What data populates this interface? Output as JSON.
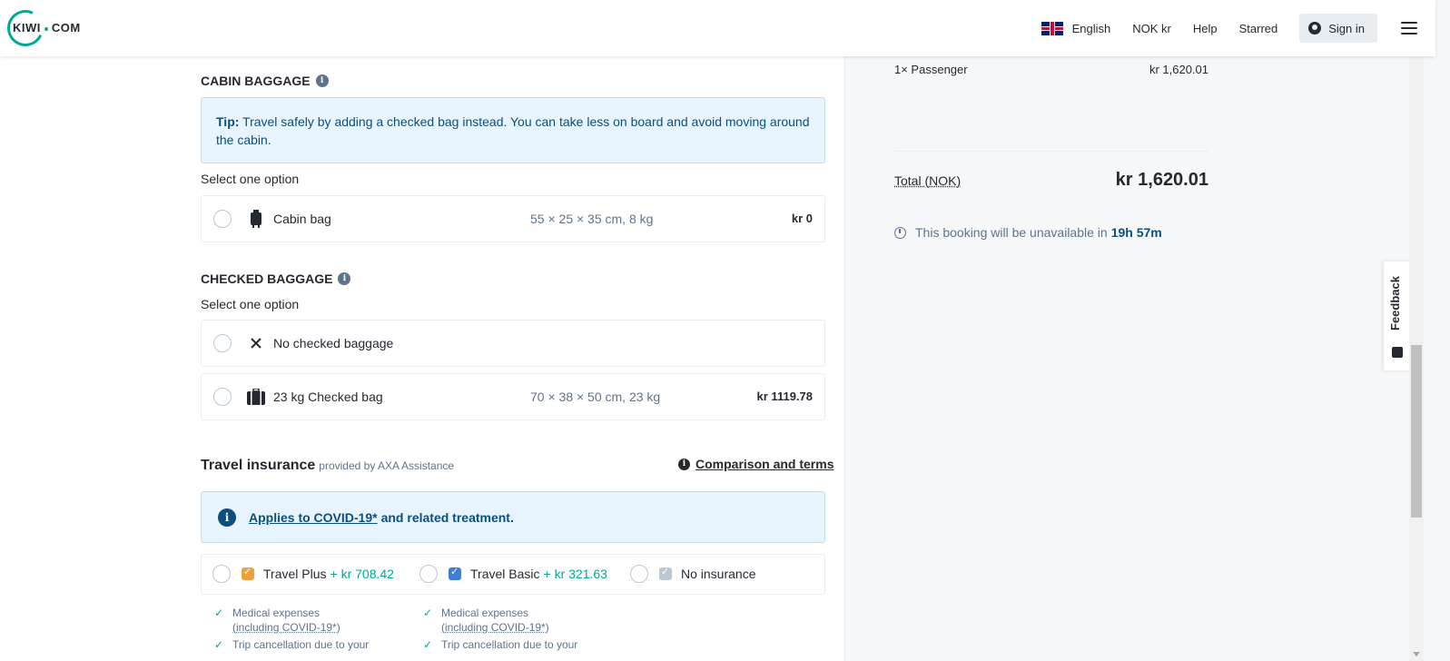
{
  "header": {
    "logo_text_left": "KIWI",
    "logo_text_right": "COM",
    "language": "English",
    "currency": "NOK kr",
    "help": "Help",
    "starred": "Starred",
    "sign_in": "Sign in"
  },
  "cabin": {
    "title": "CABIN BAGGAGE",
    "tip_bold": "Tip:",
    "tip_text": " Travel safely by adding a checked bag instead. You can take less on board and avoid moving around the cabin.",
    "select_label": "Select one option",
    "options": [
      {
        "label": "Cabin bag",
        "dims": "55 × 25 × 35 cm, 8 kg",
        "price": "kr 0"
      }
    ]
  },
  "checked": {
    "title": "CHECKED BAGGAGE",
    "select_label": "Select one option",
    "options": [
      {
        "label": "No checked baggage"
      },
      {
        "label": "23 kg Checked bag",
        "dims": "70 × 38 × 50 cm, 23 kg",
        "price": "kr 1119.78"
      }
    ]
  },
  "insurance": {
    "title": "Travel insurance",
    "provider": "provided by AXA Assistance",
    "comparison": "Comparison and terms",
    "covid_link": "Applies to COVID-19*",
    "covid_rest": "and related treatment.",
    "options": [
      {
        "label": "Travel Plus",
        "price": "+ kr 708.42",
        "color": "#f0a03a"
      },
      {
        "label": "Travel Basic",
        "price": "+ kr 321.63",
        "color": "#3d7fd6"
      },
      {
        "label": "No insurance"
      }
    ],
    "features_col1": [
      {
        "line1": "Medical expenses",
        "line2": "(including COVID-19*)"
      },
      {
        "line1": "Trip cancellation due to your"
      }
    ],
    "features_col2": [
      {
        "line1": "Medical expenses",
        "line2": "(including COVID-19*)"
      },
      {
        "line1": "Trip cancellation due to your"
      }
    ]
  },
  "summary": {
    "passenger_label": "1× Passenger",
    "passenger_price": "kr 1,620.01",
    "total_label": "Total (NOK)",
    "total_value": "kr 1,620.01",
    "timer_text": "This booking will be unavailable in",
    "timer_value": "19h 57m"
  },
  "feedback": "Feedback",
  "colors": {
    "accent": "#00a991",
    "info_blue": "#0b4f7c",
    "info_bg": "#e8f4fd"
  }
}
